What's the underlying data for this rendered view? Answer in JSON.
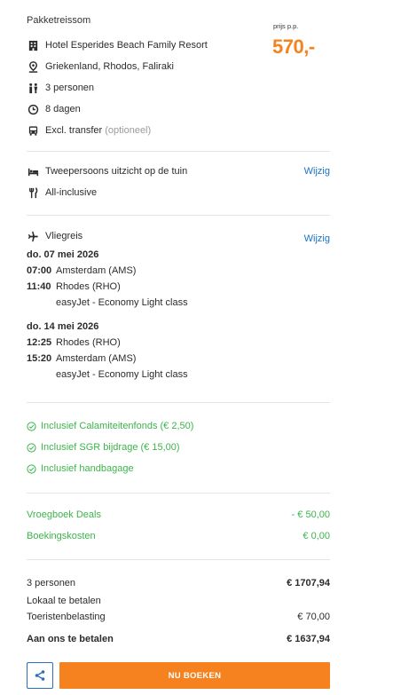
{
  "header": {
    "title": "Pakketreissom",
    "price_label": "prijs p.p.",
    "price": "570,-"
  },
  "summary": {
    "hotel": "Hotel Esperides Beach Family Resort",
    "location": "Griekenland, Rhodos, Faliraki",
    "persons": "3 personen",
    "duration": "8 dagen",
    "transfer": "Excl. transfer",
    "transfer_note": "(optioneel)"
  },
  "room": {
    "type": "Tweepersoons uitzicht op de tuin",
    "board": "All-inclusive",
    "change_label": "Wijzig"
  },
  "flight": {
    "heading": "Vliegreis",
    "change_label": "Wijzig",
    "outbound": {
      "date": "do. 07 mei 2026",
      "dep_time": "07:00",
      "dep_place": "Amsterdam (AMS)",
      "arr_time": "11:40",
      "arr_place": "Rhodes (RHO)",
      "carrier": "easyJet - Economy Light class"
    },
    "return": {
      "date": "do. 14 mei 2026",
      "dep_time": "12:25",
      "dep_place": "Rhodes (RHO)",
      "arr_time": "15:20",
      "arr_place": "Amsterdam (AMS)",
      "carrier": "easyJet - Economy Light class"
    }
  },
  "inclusions": [
    "Inclusief Calamiteitenfonds (€ 2,50)",
    "Inclusief SGR bijdrage (€ 15,00)",
    "Inclusief handbagage"
  ],
  "discounts": {
    "early_label": "Vroegboek Deals",
    "early_value": "- € 50,00",
    "fee_label": "Boekingskosten",
    "fee_value": "€ 0,00"
  },
  "totals": {
    "persons_label": "3 personen",
    "persons_value": "€ 1707,94",
    "local_label": "Lokaal te betalen",
    "tax_label": "Toeristenbelasting",
    "tax_value": "€ 70,00",
    "pay_label": "Aan ons te betalen",
    "pay_value": "€ 1637,94"
  },
  "actions": {
    "book_label": "NU BOEKEN"
  },
  "colors": {
    "accent": "#f5821f",
    "link": "#1a73c7",
    "success": "#3bb54a"
  }
}
